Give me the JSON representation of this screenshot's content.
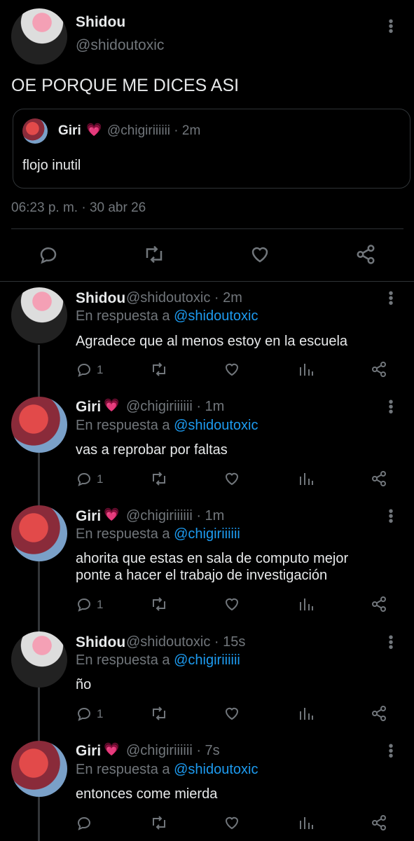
{
  "main": {
    "author_name": "Shidou",
    "author_handle": "@shidoutoxic",
    "text": "OE PORQUE ME DICES ASI",
    "quote": {
      "name": "Giri",
      "handle_time": "@chigiriiiiii · 2m",
      "text": "flojo inutil"
    },
    "timestamp": "06:23 p. m. · 30 abr 26"
  },
  "replies": [
    {
      "name": "Shidou",
      "handle_time": "@shidoutoxic · 2m",
      "reply_prefix": "En respuesta a",
      "reply_to": "@shidoutoxic",
      "text": "Agradece que al menos estoy en la escuela",
      "reply_count": "1"
    },
    {
      "name": "Giri",
      "handle_time": "@chigiriiiiii · 1m",
      "reply_prefix": "En respuesta a",
      "reply_to": "@shidoutoxic",
      "text": "vas a reprobar por faltas",
      "reply_count": "1"
    },
    {
      "name": "Giri",
      "handle_time": "@chigiriiiiii · 1m",
      "reply_prefix": "En respuesta a",
      "reply_to": "@chigiriiiiii",
      "text_line1": "ahorita que estas en sala de computo mejor",
      "text_line2": "ponte a hacer el trabajo de investigación",
      "reply_count": "1"
    },
    {
      "name": "Shidou",
      "handle_time": "@shidoutoxic · 15s",
      "reply_prefix": "En respuesta a",
      "reply_to": "@chigiriiiiii",
      "text": "ño",
      "reply_count": "1"
    },
    {
      "name": "Giri",
      "handle_time": "@chigiriiiiii · 7s",
      "reply_prefix": "En respuesta a",
      "reply_to": "@shidoutoxic",
      "text": "entonces come mierda"
    }
  ],
  "icons": {
    "heart_emoji": "💗",
    "more": "more-vertical-icon"
  },
  "colors": {
    "background": "#000000",
    "text": "#e7e9ea",
    "muted": "#71767b",
    "link": "#1d9bf0",
    "divider": "#2f3336"
  }
}
